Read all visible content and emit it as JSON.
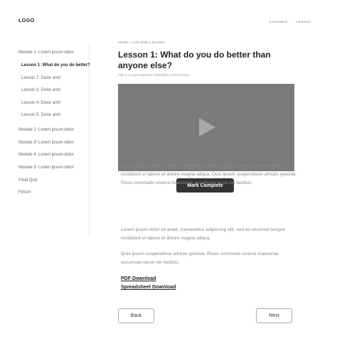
{
  "header": {
    "logo": "LOGO",
    "nav": [
      "COURSES",
      "LOGOUT"
    ]
  },
  "sidebar": {
    "items": [
      {
        "label": "Module 1: Lorem ipsum dolor"
      },
      {
        "label": "Lesson 1: What do you do better?",
        "active": true
      },
      {
        "label": "Lesson 2: Dolor amit"
      },
      {
        "label": "Lesson 3: Dolor amit"
      },
      {
        "label": "Lesson 4: Dolor amit"
      },
      {
        "label": "Lesson 5: Dolor amit"
      },
      {
        "label": "Module 2: Lorem ipsum dolor"
      },
      {
        "label": "Module 3: Lorem ipsum dolor"
      },
      {
        "label": "Module 4: Lorem ipsum dolor"
      },
      {
        "label": "Module 5: Lorem ipsum dolor"
      },
      {
        "label": "Final Quiz"
      },
      {
        "label": "Finish!"
      }
    ]
  },
  "lesson": {
    "breadcrumb": "Module 1: Let's Make a Decision!",
    "title": "Lesson 1: What do you do better than anyone else?",
    "subtitle": "This is a super awesome description of this lesson.",
    "mark_complete": "Mark Complete",
    "paragraphs": [
      "Lorem ipsum dolor sit amet, consectetur adipiscing elit, sed do eiusmod tempor incididunt ut labore et dolore magna aliqua. Quis ipsum suspendisse ultrices gravida. Risus commodo viverra maecenas accumsan lacus vel facilisis.",
      "Lorem ipsum dolor sit amet, consectetur adipiscing elit, sed do eiusmod tempor incididunt ut labore et dolore magna aliqua.",
      "Quis ipsum suspendisse ultrices gravida. Risus commodo viverra maecenas accumsan lacus vel facilisis."
    ],
    "downloads": [
      "PDF Download",
      "Spreadsheet Download"
    ]
  },
  "footer_nav": {
    "back": "Back",
    "next": "Next"
  }
}
